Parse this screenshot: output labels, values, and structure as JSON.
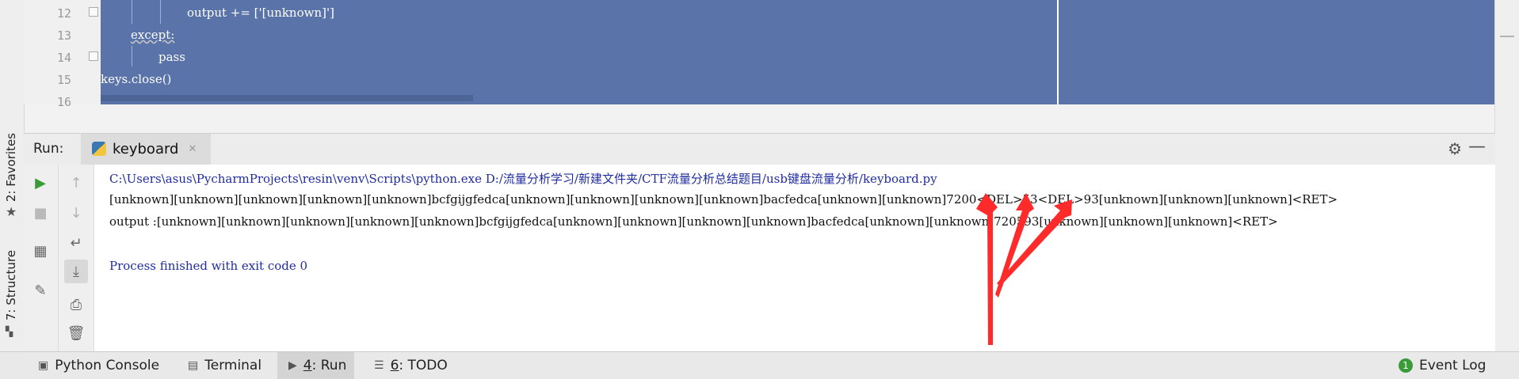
{
  "editor": {
    "lines": [
      {
        "num": "12",
        "text": "output += ['[unknown]']"
      },
      {
        "num": "13",
        "text": "except:"
      },
      {
        "num": "14",
        "text": "pass"
      },
      {
        "num": "15",
        "text": "keys.close()"
      },
      {
        "num": "16",
        "text": ""
      }
    ]
  },
  "sidetabs": {
    "favorites": "2: Favorites",
    "structure": "7: Structure"
  },
  "run": {
    "label": "Run:",
    "tab_name": "keyboard",
    "output": [
      "C:\\Users\\asus\\PycharmProjects\\resin\\venv\\Scripts\\python.exe D:/流量分析学习/新建文件夹/CTF流量分析总结题目/usb键盘流量分析/keyboard.py",
      "[unknown][unknown][unknown][unknown][unknown]bcfgijgfedca[unknown][unknown][unknown][unknown]bacfedca[unknown][unknown]7200<DEL>53<DEL>93[unknown][unknown][unknown]<RET>",
      "output :[unknown][unknown][unknown][unknown][unknown]bcfgijgfedca[unknown][unknown][unknown][unknown]bacfedca[unknown][unknown]720593[unknown][unknown][unknown]<RET>",
      "",
      "Process finished with exit code 0"
    ]
  },
  "statusbar": {
    "python_console": "Python Console",
    "terminal": "Terminal",
    "run_num": "4",
    "run_label": ": Run",
    "todo_num": "6",
    "todo_label": ": TODO",
    "event_log": "Event Log",
    "event_count": "1"
  },
  "colors": {
    "selection": "#5a73a8",
    "console_path": "#1f2da0",
    "annotation_arrow": "#ff2a2a",
    "run_green": "#3a9b3a"
  }
}
